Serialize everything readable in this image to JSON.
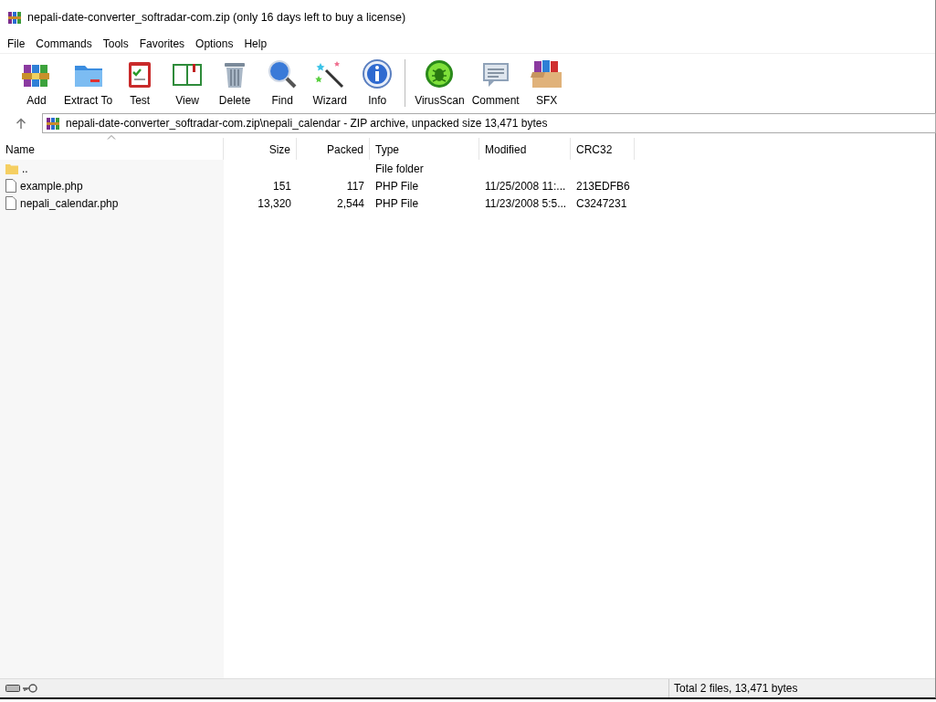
{
  "window": {
    "title": "nepali-date-converter_softradar-com.zip (only 16 days left to buy a license)"
  },
  "menu": [
    "File",
    "Commands",
    "Tools",
    "Favorites",
    "Options",
    "Help"
  ],
  "toolbar": {
    "groups": [
      [
        "Add",
        "Extract To",
        "Test",
        "View",
        "Delete",
        "Find",
        "Wizard",
        "Info"
      ],
      [
        "VirusScan",
        "Comment",
        "SFX"
      ]
    ]
  },
  "address": {
    "path": "nepali-date-converter_softradar-com.zip\\nepali_calendar - ZIP archive, unpacked size 13,471 bytes"
  },
  "table": {
    "columns": [
      {
        "label": "Name",
        "sorted": true
      },
      {
        "label": "Size",
        "sorted": false
      },
      {
        "label": "Packed",
        "sorted": false
      },
      {
        "label": "Type",
        "sorted": false
      },
      {
        "label": "Modified",
        "sorted": false
      },
      {
        "label": "CRC32",
        "sorted": false
      }
    ],
    "rows": [
      {
        "kind": "folder",
        "cells": [
          "..",
          "",
          "",
          "File folder",
          "",
          ""
        ]
      },
      {
        "kind": "file",
        "cells": [
          "example.php",
          "151",
          "117",
          "PHP File",
          "11/25/2008 11:...",
          "213EDFB6"
        ]
      },
      {
        "kind": "file",
        "cells": [
          "nepali_calendar.php",
          "13,320",
          "2,544",
          "PHP File",
          "11/23/2008 5:5...",
          "C3247231"
        ]
      }
    ]
  },
  "status_bar": {
    "text": "Total 2 files, 13,471 bytes"
  }
}
